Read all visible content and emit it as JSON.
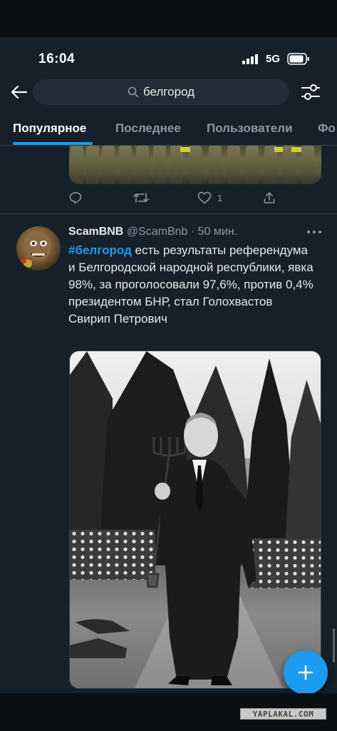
{
  "status_bar": {
    "time": "16:04",
    "network": "5G"
  },
  "search": {
    "query": "белгород"
  },
  "tabs": [
    {
      "label": "Популярное",
      "active": true
    },
    {
      "label": "Последнее",
      "active": false
    },
    {
      "label": "Пользователи",
      "active": false
    },
    {
      "label": "Фо",
      "active": false
    }
  ],
  "previous_tweet": {
    "like_count": "1"
  },
  "tweet": {
    "display_name": "ScamBNB",
    "handle": "@ScamBnb",
    "separator": "·",
    "time_ago": "50 мин.",
    "hashtag": "#белгород",
    "text": " есть результаты референдума и Белгородской народной республики, явка 98%, за проголосовали 97,6%, против 0,4% президентом БНР, стал Голохвастов Свирип Петрович"
  },
  "watermark": "YAPLAKAL.COM",
  "colors": {
    "background": "#15202b",
    "accent": "#1d9bf0",
    "text_primary": "#e7e9ea",
    "text_secondary": "#8b98a5"
  },
  "icons": [
    "back-arrow-icon",
    "search-icon",
    "filter-icon",
    "reply-icon",
    "retweet-icon",
    "like-icon",
    "share-icon",
    "more-icon",
    "compose-plus-icon",
    "signal-icon",
    "battery-icon"
  ]
}
